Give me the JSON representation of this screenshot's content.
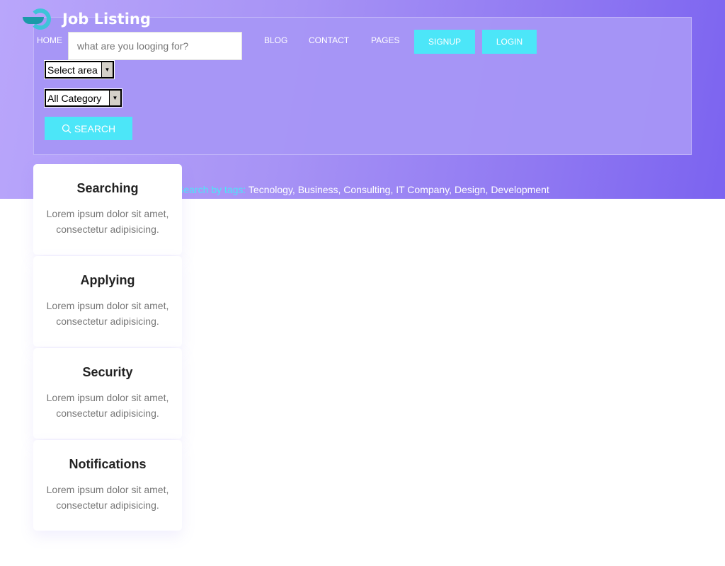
{
  "brand": {
    "name": "Job Listing"
  },
  "nav": {
    "items": [
      "HOME",
      "BLOG",
      "CONTACT",
      "PAGES"
    ],
    "signup": "SIGNUP",
    "login": "LOGIN"
  },
  "search": {
    "placeholder": "what are you looging for?",
    "area": "Select area",
    "category": "All Category",
    "button": "SEARCH"
  },
  "tags": {
    "label": "Search by tags:",
    "list": "Tecnology, Business, Consulting, IT Company, Design, Development"
  },
  "features": [
    {
      "title": "Searching",
      "text": "Lorem ipsum dolor sit amet, consectetur adipisicing."
    },
    {
      "title": "Applying",
      "text": "Lorem ipsum dolor sit amet, consectetur adipisicing."
    },
    {
      "title": "Security",
      "text": "Lorem ipsum dolor sit amet, consectetur adipisicing."
    },
    {
      "title": "Notifications",
      "text": "Lorem ipsum dolor sit amet, consectetur adipisicing."
    }
  ],
  "colors": {
    "accent": "#4ce6f8",
    "hero": "#a793f5"
  }
}
